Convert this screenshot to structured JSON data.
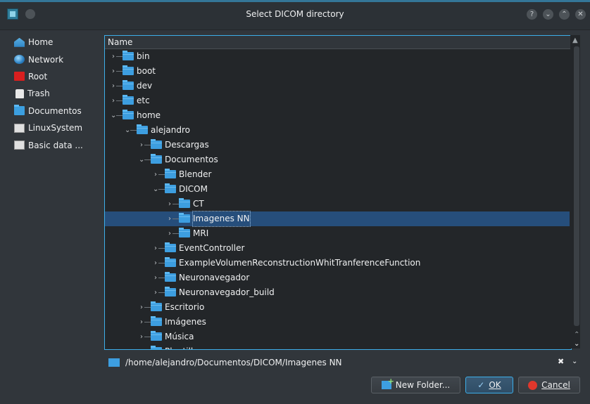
{
  "window": {
    "title": "Select DICOM directory",
    "controls": [
      "?",
      "⌄",
      "⌃",
      "✕"
    ]
  },
  "sidebar": {
    "items": [
      {
        "label": "Home",
        "icon": "home-icon"
      },
      {
        "label": "Network",
        "icon": "network-icon"
      },
      {
        "label": "Root",
        "icon": "root-icon"
      },
      {
        "label": "Trash",
        "icon": "trash-icon"
      },
      {
        "label": "Documentos",
        "icon": "folder-icon"
      },
      {
        "label": "LinuxSystem",
        "icon": "drive-icon"
      },
      {
        "label": "Basic data ...",
        "icon": "drive-icon"
      }
    ]
  },
  "tree": {
    "header": "Name",
    "rows": [
      {
        "label": "bin",
        "depth": 0,
        "expanded": false
      },
      {
        "label": "boot",
        "depth": 0,
        "expanded": false
      },
      {
        "label": "dev",
        "depth": 0,
        "expanded": false
      },
      {
        "label": "etc",
        "depth": 0,
        "expanded": false
      },
      {
        "label": "home",
        "depth": 0,
        "expanded": true
      },
      {
        "label": "alejandro",
        "depth": 1,
        "expanded": true
      },
      {
        "label": "Descargas",
        "depth": 2,
        "expanded": false
      },
      {
        "label": "Documentos",
        "depth": 2,
        "expanded": true
      },
      {
        "label": "Blender",
        "depth": 3,
        "expanded": false
      },
      {
        "label": "DICOM",
        "depth": 3,
        "expanded": true
      },
      {
        "label": "CT",
        "depth": 4,
        "expanded": false
      },
      {
        "label": "Imagenes NN",
        "depth": 4,
        "expanded": false,
        "selected": true
      },
      {
        "label": "MRI",
        "depth": 4,
        "expanded": false
      },
      {
        "label": "EventController",
        "depth": 3,
        "expanded": false
      },
      {
        "label": "ExampleVolumenReconstructionWhitTranferenceFunction",
        "depth": 3,
        "expanded": false
      },
      {
        "label": "Neuronavegador",
        "depth": 3,
        "expanded": false
      },
      {
        "label": "Neuronavegador_build",
        "depth": 3,
        "expanded": false
      },
      {
        "label": "Escritorio",
        "depth": 2,
        "expanded": false
      },
      {
        "label": "Imágenes",
        "depth": 2,
        "expanded": false
      },
      {
        "label": "Música",
        "depth": 2,
        "expanded": false
      },
      {
        "label": "Plantillas",
        "depth": 2,
        "expanded": false
      }
    ]
  },
  "path": {
    "value": "/home/alejandro/Documentos/DICOM/Imagenes NN"
  },
  "buttons": {
    "new_folder": "New Folder...",
    "ok": "OK",
    "cancel": "Cancel"
  },
  "colors": {
    "accent": "#3daee9",
    "selection": "#264e7b",
    "folder": "#3d9ee0",
    "background": "#31363b",
    "view_background": "#232629"
  }
}
